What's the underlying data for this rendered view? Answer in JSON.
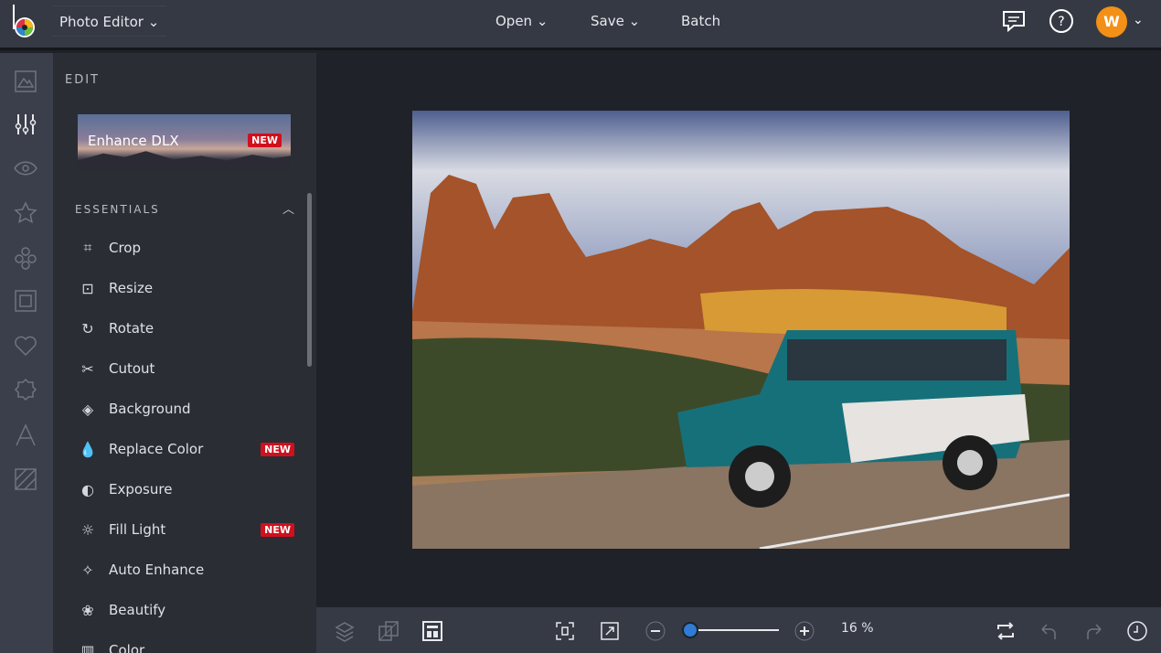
{
  "header": {
    "app_title": "Photo Editor",
    "menus": [
      "Open",
      "Save",
      "Batch"
    ],
    "avatar_initial": "W"
  },
  "panel": {
    "section_title": "EDIT",
    "banner": {
      "label": "Enhance DLX",
      "badge": "NEW"
    },
    "group": "ESSENTIALS",
    "items": [
      {
        "label": "Crop",
        "icon": "crop-icon"
      },
      {
        "label": "Resize",
        "icon": "resize-icon"
      },
      {
        "label": "Rotate",
        "icon": "rotate-icon"
      },
      {
        "label": "Cutout",
        "icon": "scissors-icon"
      },
      {
        "label": "Background",
        "icon": "background-icon"
      },
      {
        "label": "Replace Color",
        "icon": "drop-icon",
        "badge": "NEW"
      },
      {
        "label": "Exposure",
        "icon": "exposure-icon"
      },
      {
        "label": "Fill Light",
        "icon": "sun-icon",
        "badge": "NEW"
      },
      {
        "label": "Auto Enhance",
        "icon": "wand-icon"
      },
      {
        "label": "Beautify",
        "icon": "flower-icon"
      },
      {
        "label": "Color",
        "icon": "color-icon"
      }
    ]
  },
  "footer": {
    "zoom_label": "16 %",
    "zoom_percent": 16
  },
  "colors": {
    "accent": "#2f7bd6",
    "badge": "#d0101d",
    "avatar": "#f39016"
  }
}
